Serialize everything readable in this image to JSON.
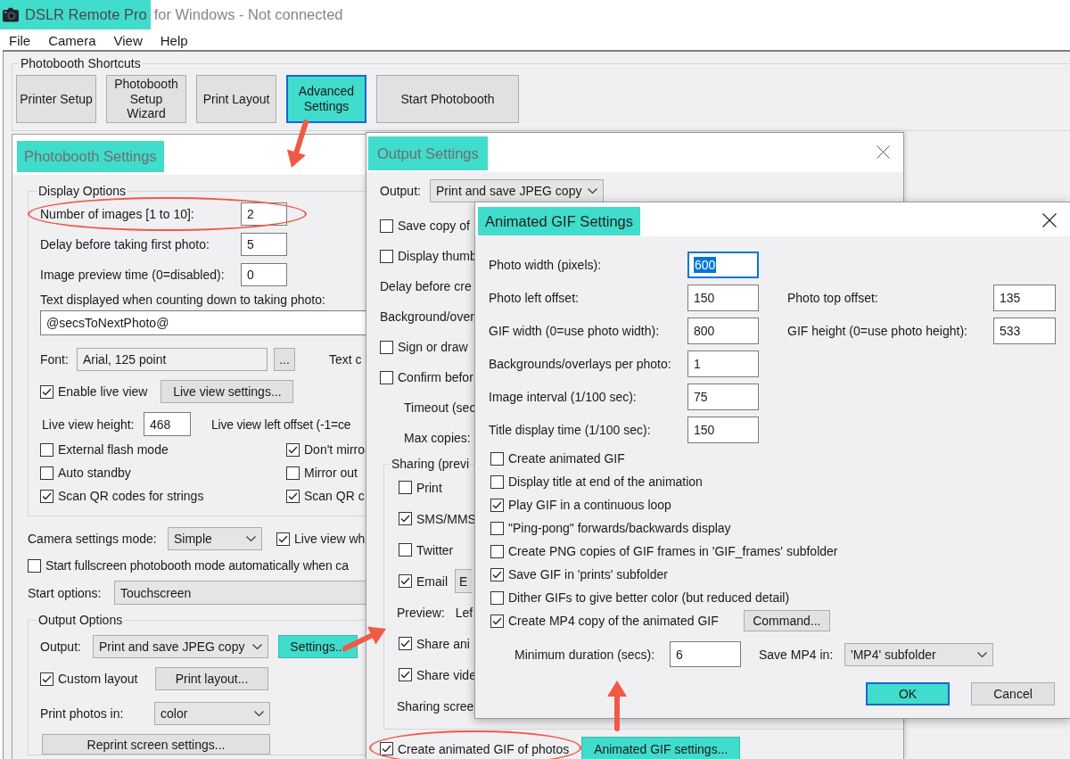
{
  "window": {
    "app_name": "DSLR Remote Pro",
    "app_name_highlighted": true,
    "title_rest": "for Windows - Not connected"
  },
  "menu": [
    "File",
    "Camera",
    "View",
    "Help"
  ],
  "shortcuts": {
    "label": "Photobooth Shortcuts",
    "buttons": [
      {
        "label": "Printer Setup",
        "highlighted": false,
        "focused": false
      },
      {
        "label": "Photobooth Setup Wizard",
        "highlighted": false,
        "focused": false
      },
      {
        "label": "Print Layout",
        "highlighted": false,
        "focused": false
      },
      {
        "label": "Advanced Settings",
        "highlighted": true,
        "focused": true
      },
      {
        "label": "Start Photobooth",
        "highlighted": false,
        "focused": false
      }
    ]
  },
  "photobooth_settings": {
    "title": "Photobooth Settings",
    "title_highlighted": true,
    "display_options": {
      "label": "Display Options",
      "fields": [
        {
          "label": "Number of images [1 to 10]:",
          "value": "2",
          "circled": true
        },
        {
          "label": "Delay before taking first photo:",
          "value": "5",
          "circled": false
        },
        {
          "label": "Image preview time (0=disabled):",
          "value": "0",
          "circled": false
        }
      ],
      "countdown_text": {
        "label": "Text displayed when counting down to taking photo:",
        "value": "@secsToNextPhoto@"
      },
      "font": {
        "label": "Font:",
        "value": "Arial, 125 point",
        "button": "...",
        "side_label": "Text c"
      },
      "live_view": {
        "label": "Enable live view",
        "checked": true,
        "button": "Live view settings..."
      },
      "live_view_height": {
        "label": "Live view height:",
        "value": "468",
        "side_label": "Live view left offset (-1=ce"
      },
      "checkboxes": [
        {
          "label": "External flash mode",
          "checked": false
        },
        {
          "label": "Don't mirro",
          "checked": true
        },
        {
          "label": "Auto standby",
          "checked": false
        },
        {
          "label": "Mirror out",
          "checked": false
        },
        {
          "label": "Scan QR codes for strings",
          "checked": true
        },
        {
          "label": "Scan QR c",
          "checked": true
        }
      ]
    },
    "camera_mode": {
      "label": "Camera settings mode:",
      "value": "Simple",
      "checkbox_label": "Live view wh",
      "checked": true
    },
    "fullscreen": {
      "label": "Start fullscreen photobooth mode automatically when ca",
      "checked": false
    },
    "start_options": {
      "label": "Start options:",
      "value": "Touchscreen"
    },
    "output_options": {
      "label": "Output Options",
      "output": {
        "label": "Output:",
        "value": "Print and save JPEG copy",
        "button": "Settings...",
        "button_highlighted": true
      },
      "custom_layout": {
        "label": "Custom layout",
        "checked": true,
        "button": "Print layout..."
      },
      "print_photos": {
        "label": "Print photos in:",
        "value": "color"
      },
      "reprint_button": "Reprint screen settings..."
    }
  },
  "output_settings": {
    "title": "Output Settings",
    "title_highlighted": true,
    "output": {
      "label": "Output:",
      "value": "Print and save JPEG copy"
    },
    "rows": [
      {
        "kind": "checkbox",
        "label": "Save copy of",
        "checked": false
      },
      {
        "kind": "checkbox",
        "label": "Display thumb",
        "checked": false
      },
      {
        "kind": "label",
        "label": "Delay before cre"
      },
      {
        "kind": "label",
        "label": "Background/over"
      },
      {
        "kind": "checkbox",
        "label": "Sign or draw",
        "checked": false
      },
      {
        "kind": "checkbox",
        "label": "Confirm befor",
        "checked": false
      },
      {
        "kind": "sublabel",
        "label": "Timeout (sec"
      },
      {
        "kind": "sublabel",
        "label": "Max copies:"
      }
    ],
    "sharing": {
      "label": "Sharing (previ",
      "items": [
        {
          "kind": "checkbox",
          "label": "Print",
          "checked": false
        },
        {
          "kind": "checkbox",
          "label": "SMS/MMS",
          "checked": true
        },
        {
          "kind": "checkbox",
          "label": "Twitter",
          "checked": false
        },
        {
          "kind": "checkbox",
          "label": "Email",
          "checked": true,
          "button": "E"
        },
        {
          "kind": "preview",
          "label": "Preview:",
          "value": "Lef"
        },
        {
          "kind": "checkbox",
          "label": "Share ani",
          "checked": true
        },
        {
          "kind": "checkbox",
          "label": "Share vide",
          "checked": true
        },
        {
          "kind": "label",
          "label": "Sharing scree"
        }
      ]
    },
    "create_gif": {
      "label": "Create animated GIF of photos",
      "checked": true,
      "circled": true
    },
    "gif_button": {
      "label": "Animated GIF settings...",
      "highlighted": true
    }
  },
  "gif_settings": {
    "title": "Animated GIF Settings",
    "title_highlighted": true,
    "field_rows": [
      {
        "fields": [
          {
            "label": "Photo width (pixels):",
            "value": "600",
            "text_selected": true
          }
        ]
      },
      {
        "fields": [
          {
            "label": "Photo left offset:",
            "value": "150",
            "text_selected": false
          },
          {
            "label": "Photo top offset:",
            "value": "135",
            "text_selected": false
          }
        ]
      },
      {
        "fields": [
          {
            "label": "GIF width (0=use photo width):",
            "value": "800",
            "text_selected": false
          },
          {
            "label": "GIF height (0=use photo height):",
            "value": "533",
            "text_selected": false
          }
        ]
      },
      {
        "fields": [
          {
            "label": "Backgrounds/overlays per photo:",
            "value": "1",
            "text_selected": false
          }
        ]
      },
      {
        "fields": [
          {
            "label": "Image interval (1/100 sec):",
            "value": "75",
            "text_selected": false
          }
        ]
      },
      {
        "fields": [
          {
            "label": "Title display time (1/100 sec):",
            "value": "150",
            "text_selected": false
          }
        ]
      }
    ],
    "checkboxes": [
      {
        "label": "Create animated GIF",
        "checked": false
      },
      {
        "label": "Display title at end of the animation",
        "checked": false
      },
      {
        "label": "Play GIF in a continuous loop",
        "checked": true
      },
      {
        "label": "\"Ping-pong\" forwards/backwards display",
        "checked": false
      },
      {
        "label": "Create PNG copies of GIF frames in 'GIF_frames' subfolder",
        "checked": false
      },
      {
        "label": "Save GIF in 'prints' subfolder",
        "checked": true
      },
      {
        "label": "Dither GIFs to give better color (but reduced detail)",
        "checked": false
      },
      {
        "label": "Create MP4 copy of the animated GIF",
        "checked": true,
        "button": "Command..."
      }
    ],
    "min_duration": {
      "label": "Minimum duration (secs):",
      "value": "6"
    },
    "save_mp4": {
      "label": "Save MP4 in:",
      "value": "'MP4' subfolder"
    },
    "buttons": [
      {
        "label": "OK",
        "highlighted": true,
        "focused": true
      },
      {
        "label": "Cancel",
        "highlighted": false,
        "focused": false
      }
    ]
  }
}
